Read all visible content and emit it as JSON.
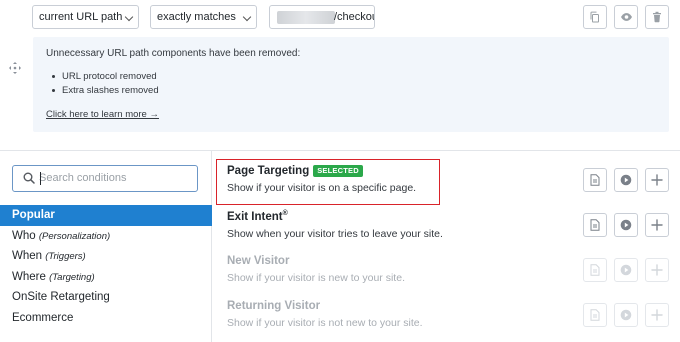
{
  "rule": {
    "target_select": "current URL path",
    "match_select": "exactly matches",
    "url_value": "/checkout",
    "icons": [
      "copy-icon",
      "eye-icon",
      "trash-icon"
    ]
  },
  "notice": {
    "title": "Unnecessary URL path components have been removed:",
    "items": [
      "URL protocol removed",
      "Extra slashes removed"
    ],
    "link": "Click here to learn more →"
  },
  "sidebar": {
    "search_placeholder": "Search conditions",
    "categories": [
      {
        "label": "Popular",
        "sub": ""
      },
      {
        "label": "Who",
        "sub": "(Personalization)"
      },
      {
        "label": "When",
        "sub": "(Triggers)"
      },
      {
        "label": "Where",
        "sub": "(Targeting)"
      },
      {
        "label": "OnSite Retargeting",
        "sub": ""
      },
      {
        "label": "Ecommerce",
        "sub": ""
      }
    ],
    "active_category": "Popular"
  },
  "conditions": [
    {
      "name": "Page Targeting",
      "badge": "SELECTED",
      "trademark": "",
      "desc": "Show if your visitor is on a specific page.",
      "enabled": true
    },
    {
      "name": "Exit Intent",
      "badge": "",
      "trademark": "®",
      "desc": "Show when your visitor tries to leave your site.",
      "enabled": true
    },
    {
      "name": "New Visitor",
      "badge": "",
      "trademark": "",
      "desc": "Show if your visitor is new to your site.",
      "enabled": false
    },
    {
      "name": "Returning Visitor",
      "badge": "",
      "trademark": "",
      "desc": "Show if your visitor is not new to your site.",
      "enabled": false
    }
  ],
  "colors": {
    "accent": "#1f80d0",
    "badge": "#2ba84a",
    "highlight": "#d9232a",
    "notice_bg": "#f2f6fb"
  }
}
